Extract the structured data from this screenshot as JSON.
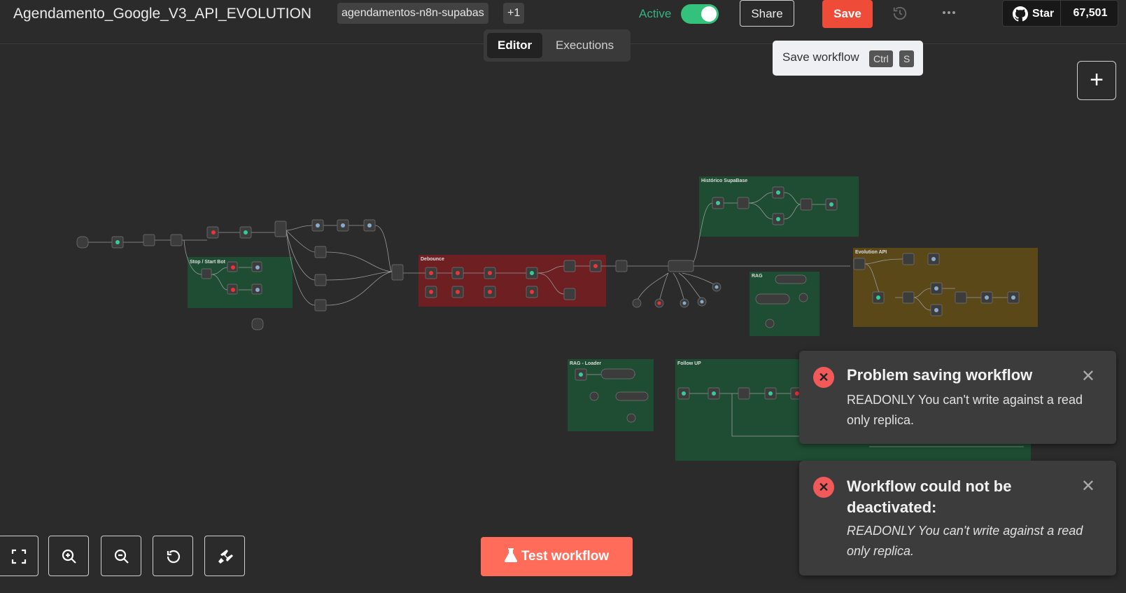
{
  "header": {
    "workflow_title": "Agendamento_Google_V3_API_EVOLUTION",
    "tag": "agendamentos-n8n-supabas",
    "tag_more": "+1",
    "active_label": "Active",
    "share_label": "Share",
    "save_label": "Save",
    "github_star_label": "Star",
    "github_stars": "67,501"
  },
  "tabs": {
    "editor": "Editor",
    "executions": "Executions"
  },
  "tooltip": {
    "text": "Save workflow",
    "key1": "Ctrl",
    "key2": "S"
  },
  "canvas": {
    "groups": {
      "historico": "Histórico SupaBase",
      "stop_start": "Stop / Start Bot",
      "debounce": "Debounce",
      "evolution": "Evolution API",
      "rag": "RAG",
      "rag_loader": "RAG - Loader",
      "follow_up": "Follow UP"
    }
  },
  "toasts": [
    {
      "title": "Problem saving workflow",
      "message": "READONLY You can't write against a read only replica."
    },
    {
      "title": "Workflow could not be deactivated:",
      "message": "READONLY You can't write against a read only replica."
    }
  ],
  "footer": {
    "test_label": "Test workflow"
  },
  "icons": {
    "github": "github-icon",
    "history": "history-icon",
    "more": "more-horizontal-icon",
    "plus": "plus-icon",
    "error": "x-circle-icon",
    "close": "close-icon",
    "fit": "fit-view-icon",
    "zoom_in": "zoom-in-icon",
    "zoom_out": "zoom-out-icon",
    "reset": "undo-icon",
    "tidy": "broom-icon",
    "flask": "flask-icon"
  },
  "colors": {
    "save": "#ee4b38",
    "active": "#34c17b",
    "test": "#ff6d5a",
    "group_green": "#1f4d33",
    "group_red": "#6e1f22",
    "group_yellow": "#5a4819",
    "error": "#f25a5a"
  }
}
